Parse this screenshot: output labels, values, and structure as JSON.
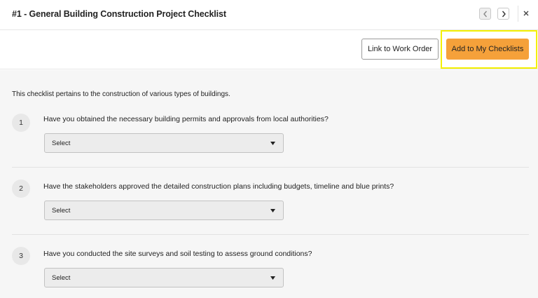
{
  "header": {
    "title": "#1 - General Building Construction Project Checklist",
    "prev_icon": "chevron-left-icon",
    "next_icon": "chevron-right-icon",
    "close_icon": "close-icon"
  },
  "toolbar": {
    "link_label": "Link to Work Order",
    "add_label": "Add to My Checklists",
    "add_color": "#f5a13a",
    "highlight_color": "#f4f000"
  },
  "intro": "This checklist pertains to the construction of various types of buildings.",
  "questions": [
    {
      "number": "1",
      "text": "Have you obtained the necessary building permits and approvals from local authorities?",
      "select_value": "Select"
    },
    {
      "number": "2",
      "text": "Have the stakeholders approved the detailed construction plans including budgets, timeline and blue prints?",
      "select_value": "Select"
    },
    {
      "number": "3",
      "text": "Have you conducted the site surveys and soil testing to assess ground conditions?",
      "select_value": "Select"
    }
  ]
}
